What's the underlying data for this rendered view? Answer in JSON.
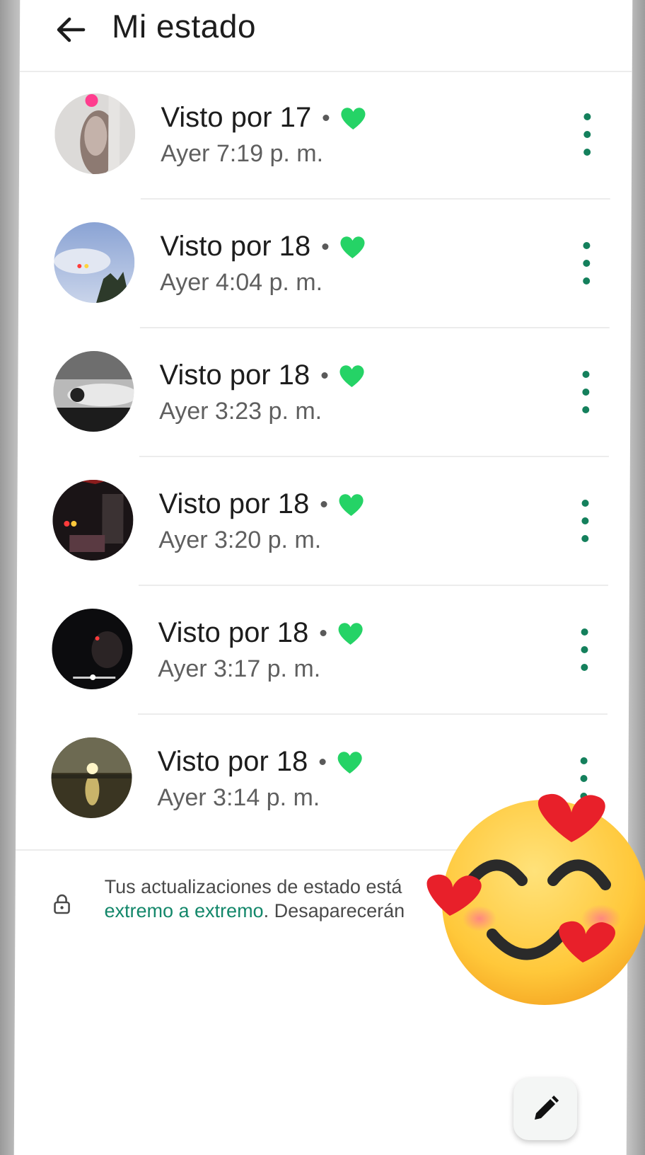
{
  "header": {
    "title": "Mi estado",
    "back_icon": "arrow-left-icon"
  },
  "statuses": [
    {
      "views": "Visto por 17",
      "time": "Ayer 7:19 p. m."
    },
    {
      "views": "Visto por 18",
      "time": "Ayer 4:04 p. m."
    },
    {
      "views": "Visto por 18",
      "time": "Ayer 3:23 p. m."
    },
    {
      "views": "Visto por 18",
      "time": "Ayer 3:20 p. m."
    },
    {
      "views": "Visto por 18",
      "time": "Ayer 3:17 p. m."
    },
    {
      "views": "Visto por 18",
      "time": "Ayer 3:14 p. m."
    }
  ],
  "footer": {
    "line1": "Tus actualizaciones de estado está",
    "link": "extremo a extremo",
    "line2_rest": ". Desaparecerán"
  },
  "fab": {
    "icon": "pencil-icon"
  },
  "colors": {
    "accent": "#25D366",
    "link": "#13876a",
    "menu_dots": "#14805c"
  }
}
